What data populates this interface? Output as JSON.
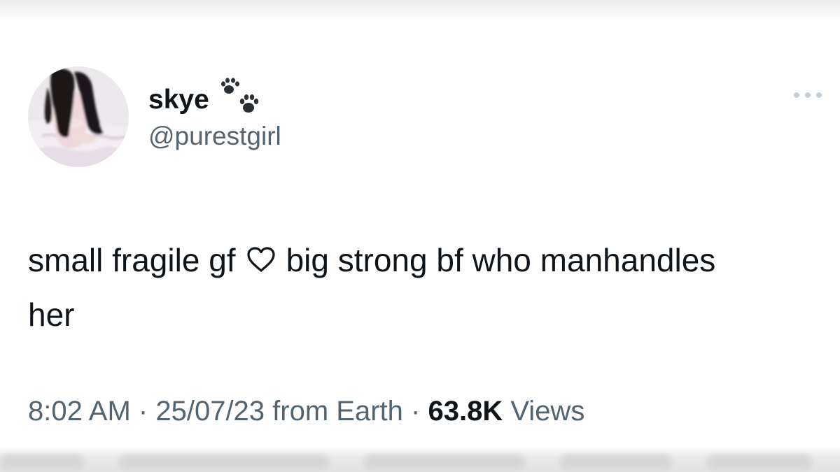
{
  "profile": {
    "display_name": "skye",
    "handle": "@purestgirl",
    "badge_icon": "paw-prints-icon"
  },
  "tweet": {
    "text_before_heart": "small fragile gf",
    "inline_icon": "heart-outline-icon",
    "text_after_heart": "big strong bf who manhandles her"
  },
  "meta": {
    "time": "8:02 AM",
    "separator": "·",
    "date_source": "25/07/23 from Earth",
    "views_count": "63.8K",
    "views_label": "Views"
  },
  "actions": {
    "more_icon": "more-horizontal-icon"
  },
  "colors": {
    "text_primary": "#0f1419",
    "text_secondary": "#536471",
    "icon_light": "#c4cfd6",
    "background": "#ffffff"
  }
}
